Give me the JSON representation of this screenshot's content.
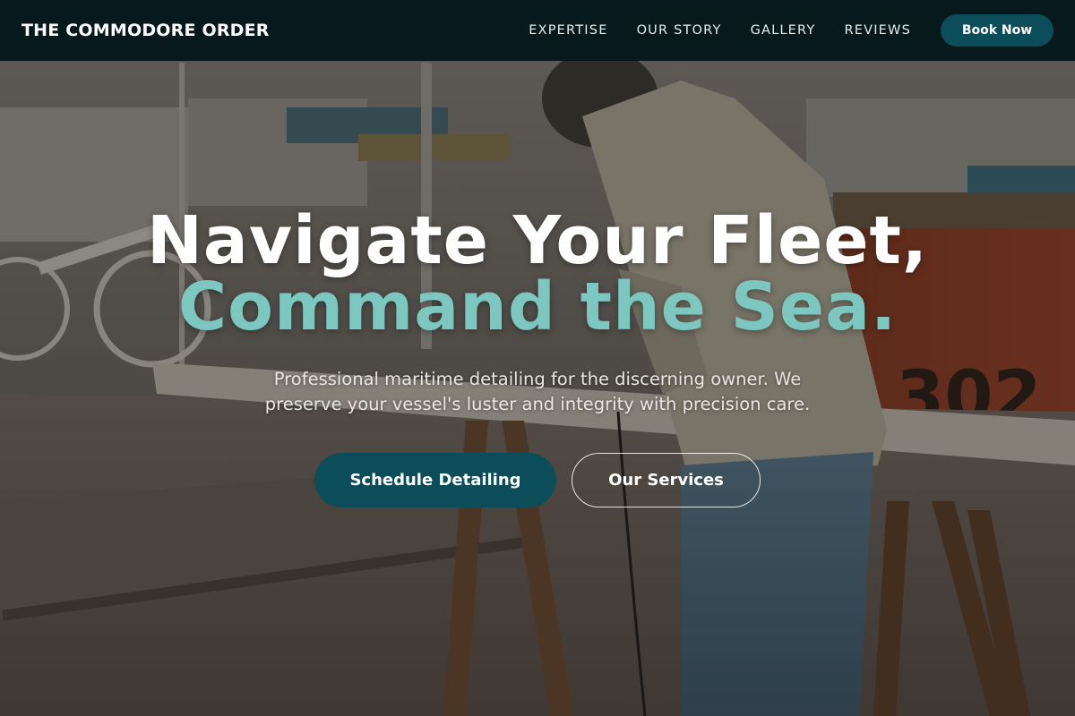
{
  "brand": {
    "name": "THE COMMODORE ORDER"
  },
  "nav": {
    "links": [
      "EXPERTISE",
      "OUR STORY",
      "GALLERY",
      "REVIEWS"
    ],
    "book_label": "Book Now"
  },
  "hero": {
    "headline_line1": "Navigate Your Fleet,",
    "headline_line2": "Command the Sea.",
    "subheading": "Professional maritime detailing for the discerning owner. We preserve your vessel's luster and integrity with precision care.",
    "primary_cta": "Schedule Detailing",
    "secondary_cta": "Our Services",
    "background_image": "boatyard-worker-photo"
  },
  "colors": {
    "nav_bg": "#08191d",
    "accent_teal": "#0b4d58",
    "headline_accent": "#7cc8c0"
  }
}
